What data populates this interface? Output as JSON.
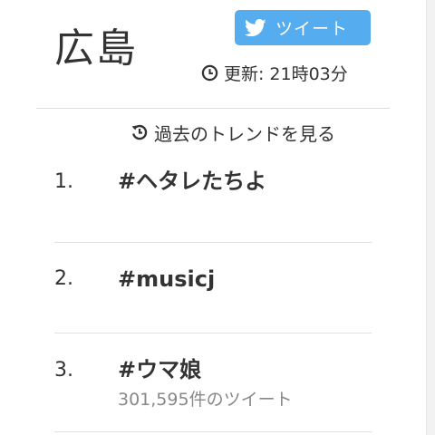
{
  "location": {
    "title": "広島"
  },
  "tweet_button": {
    "label": "ツイート",
    "icon": "twitter-bird-icon",
    "color": "#55acee"
  },
  "updated": {
    "label": "更新:",
    "time": "21時03分",
    "icon": "clock-icon"
  },
  "past_trends": {
    "label": "過去のトレンドを見る",
    "icon": "history-icon"
  },
  "trends": [
    {
      "rank": "1.",
      "name": "#ヘタレたちよ",
      "tweet_count": ""
    },
    {
      "rank": "2.",
      "name": "#musicj",
      "tweet_count": ""
    },
    {
      "rank": "3.",
      "name": "#ウマ娘",
      "tweet_count": "301,595件のツイート"
    }
  ]
}
